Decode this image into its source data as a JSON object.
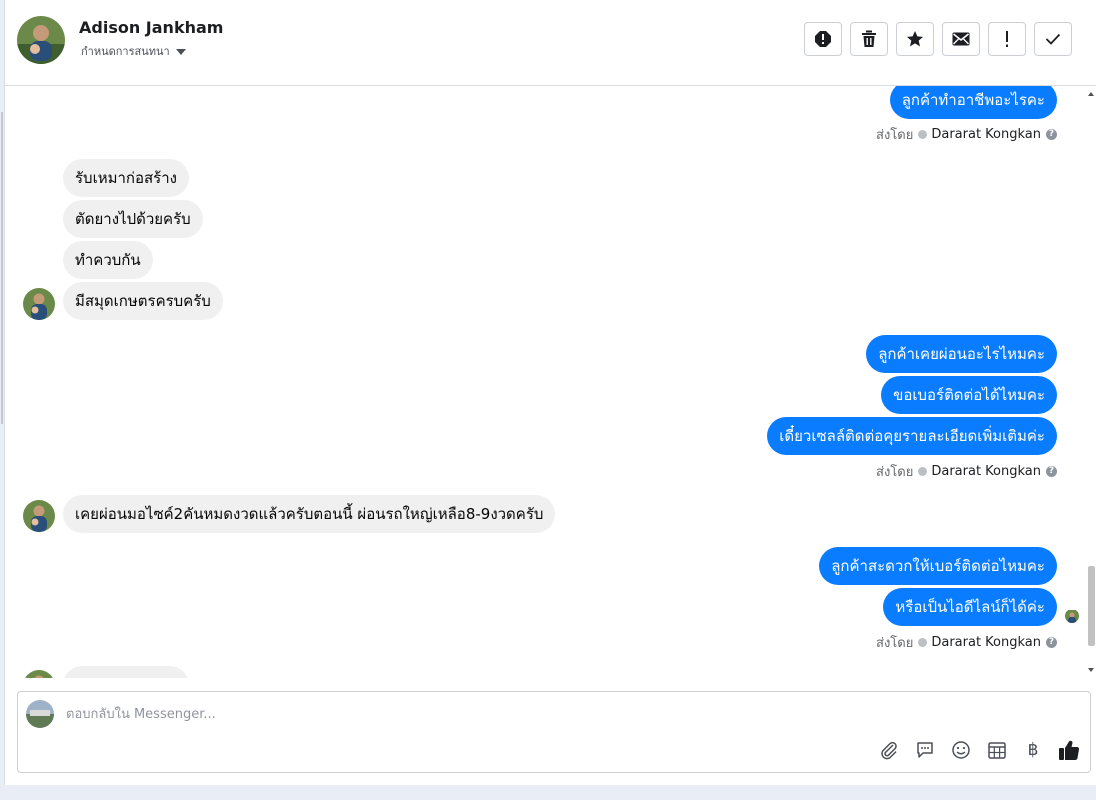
{
  "header": {
    "name": "Adison Jankham",
    "subtitle": "กำหนดการสนทนา"
  },
  "toolbar": {
    "buttons": [
      "spam-icon",
      "trash-icon",
      "star-icon",
      "mail-icon",
      "exclamation-icon",
      "check-icon"
    ]
  },
  "messages": {
    "sent_by_label": "ส่งโดย",
    "agent_name": "Dararat Kongkan",
    "group1_out": [
      "ลูกค้าทำอาชีพอะไรคะ"
    ],
    "group2_in": [
      "รับเหมาก่อสร้าง",
      "ตัดยางไปด้วยครับ",
      "ทำควบกัน",
      "มีสมุดเกษตรครบครับ"
    ],
    "group3_out": [
      "ลูกค้าเคยผ่อนอะไรไหมคะ",
      "ขอเบอร์ติดต่อได้ไหมคะ",
      "เดี๋ยวเซลล์ติดต่อคุยรายละเอียดเพิ่มเติมค่ะ"
    ],
    "group4_in": [
      "เคยผ่อนมอไซค์2คันหมดงวดแล้วครับตอนนี้ ผ่อนรถใหญ่เหลือ8-9งวดครับ"
    ],
    "group5_out": [
      "ลูกค้าสะดวกให้เบอร์ติดต่อไหมคะ",
      "หรือเป็นไอดีไลน์ก็ได้ค่ะ"
    ]
  },
  "composer": {
    "placeholder": "ตอบกลับใน Messenger...",
    "tools": [
      "attach-icon",
      "saved-reply-icon",
      "emoji-icon",
      "appointment-icon",
      "baht-icon",
      "like-icon"
    ],
    "baht_symbol": "฿"
  },
  "colors": {
    "outgoing_bubble": "#0a7cff",
    "incoming_bubble": "#f0f0f0",
    "page_background": "#e9eef6"
  }
}
